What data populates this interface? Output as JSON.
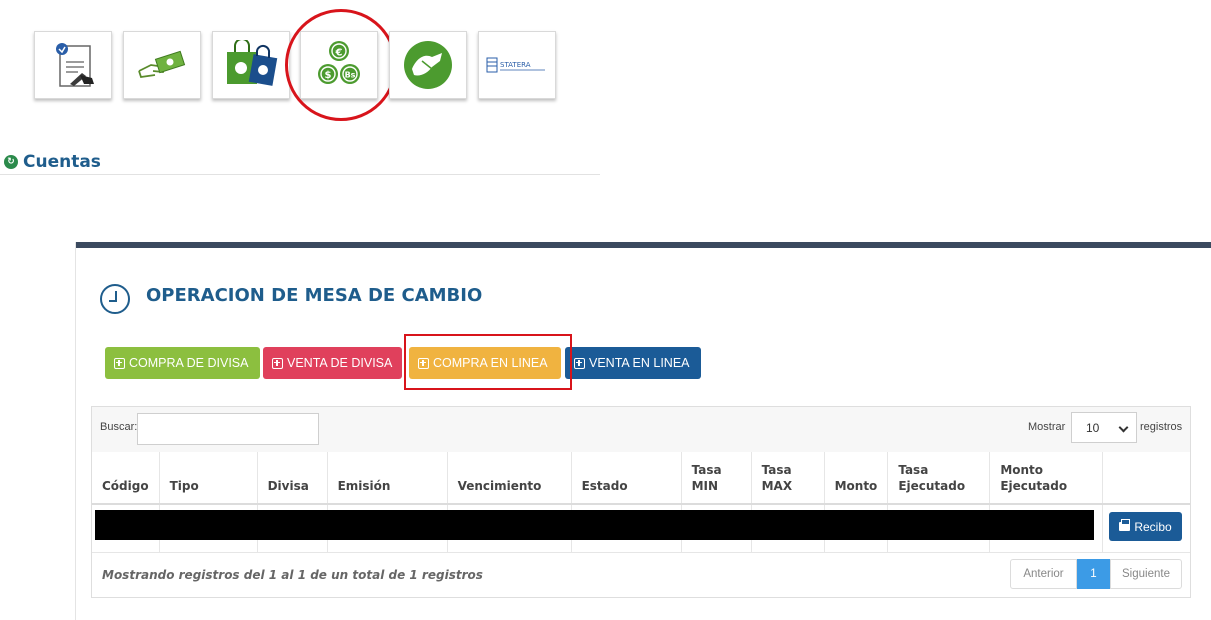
{
  "tiles": [
    {
      "name": "document-sign-icon"
    },
    {
      "name": "money-hand-icon"
    },
    {
      "name": "shopping-bags-icon"
    },
    {
      "name": "currency-exchange-icon"
    },
    {
      "name": "handshake-icon"
    },
    {
      "name": "statera-logo"
    }
  ],
  "statera_logo_text": "STATERA",
  "cuentas": {
    "title": "Cuentas"
  },
  "panel": {
    "title": "OPERACION DE MESA DE CAMBIO",
    "buttons": {
      "compra_divisa": "COMPRA DE DIVISA",
      "venta_divisa": "VENTA DE DIVISA",
      "compra_linea": "COMPRA EN LINEA",
      "venta_linea": "VENTA EN LINEA"
    }
  },
  "table": {
    "search_label": "Buscar:",
    "search_value": "",
    "show_label": "Mostrar",
    "show_value": "10",
    "records_label": "registros",
    "columns": [
      "Código",
      "Tipo",
      "Divisa",
      "Emisión",
      "Vencimiento",
      "Estado",
      "Tasa MIN",
      "Tasa MAX",
      "Monto",
      "Tasa Ejecutado",
      "Monto Ejecutado",
      ""
    ],
    "row_button": "Recibo",
    "footer": "Mostrando registros del 1 al 1 de un total de 1 registros",
    "pagination": {
      "prev": "Anterior",
      "current": "1",
      "next": "Siguiente"
    }
  },
  "colors": {
    "brand_blue": "#1f5d8c",
    "green": "#8cbf3f",
    "red": "#e0405c",
    "yellow": "#f0b340",
    "dark_blue": "#1b5b97",
    "highlight_red": "#d8141b"
  }
}
